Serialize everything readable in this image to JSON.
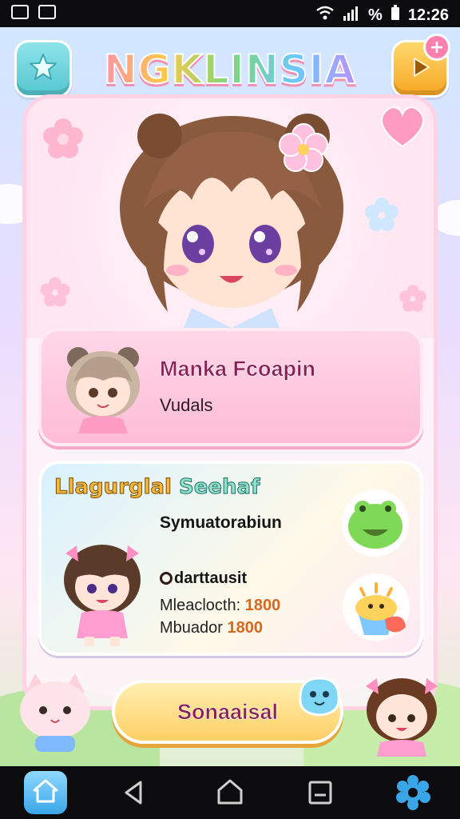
{
  "status_bar": {
    "time": "12:26",
    "signal": "%"
  },
  "header": {
    "title": "NGKLINSIA",
    "star_icon": "star-icon",
    "play_icon": "play-icon",
    "badge": "+"
  },
  "profile": {
    "name": "Manka Fcoapin",
    "subtitle": "Vudals"
  },
  "info": {
    "title_word1": "Llagurglal",
    "title_word2": "Seehaf",
    "subtitle": "Symuatorabiun",
    "heading": "darttausit",
    "stats": [
      {
        "label": "Mleaclocth:",
        "value": "1800"
      },
      {
        "label": "Mbuador",
        "value": "1800"
      }
    ]
  },
  "action_button": {
    "label": "Sonaaisal"
  },
  "nav": {
    "home": "home-icon",
    "back": "back-icon",
    "home_circle": "home-outline-icon",
    "recents": "recents-icon",
    "settings": "gear-icon"
  },
  "colors": {
    "accent_pink": "#ffbcd7",
    "accent_yellow": "#ffcf66",
    "accent_teal": "#55c6cf"
  }
}
